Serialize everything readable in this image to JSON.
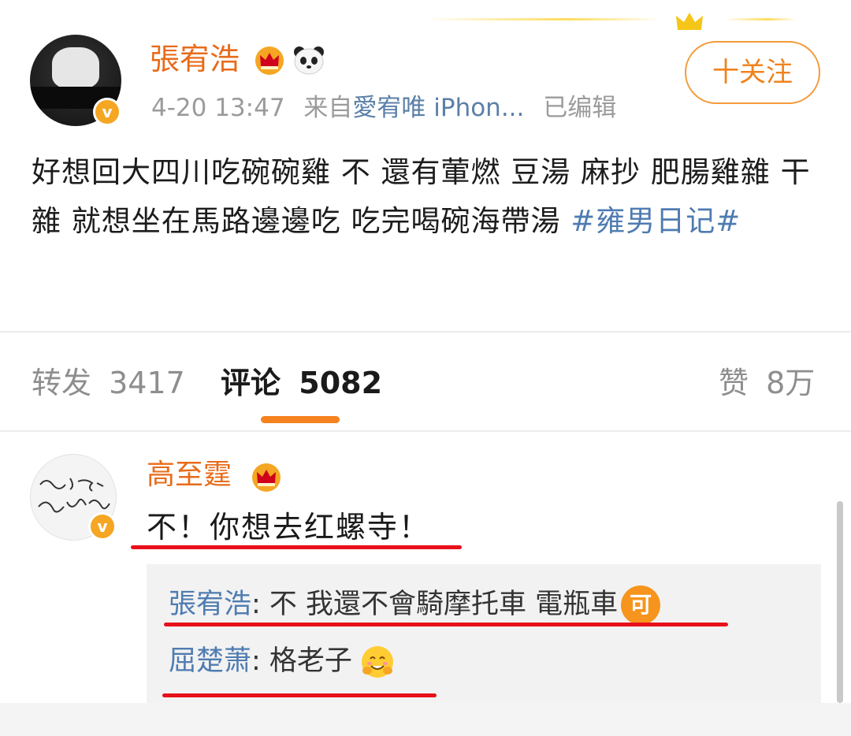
{
  "post": {
    "author": "張宥浩",
    "time": "4-20 13:47",
    "source_prefix": "来自",
    "source": "愛宥唯 iPhon...",
    "edited": "已编辑",
    "follow_label": "十关注",
    "text": "好想回大四川吃碗碗雞 不 還有葷燃 豆湯 麻抄 肥腸雞雜 干雜 就想坐在馬路邊邊吃 吃完喝碗海帶湯 ",
    "hashtag": "#雍男日记#"
  },
  "stats": {
    "repost_label": "转发",
    "repost_count": "3417",
    "comment_label": "评论",
    "comment_count": "5082",
    "like_label": "赞",
    "like_count": "8万"
  },
  "comment": {
    "author": "高至霆",
    "text": "不！你想去红螺寺！",
    "replies": [
      {
        "name": "張宥浩",
        "text": ": 不 我還不會騎摩托車 電瓶車",
        "emoji": "可"
      },
      {
        "name": "屈楚萧",
        "text": ": 格老子"
      }
    ]
  },
  "colors": {
    "accent_orange": "#f5821f",
    "name_orange": "#e86b1a",
    "link_blue": "#4f7cb1",
    "annotation_red": "#e8101a"
  },
  "icons": [
    "crown-icon",
    "panda-icon",
    "verified-badge-icon",
    "laugh-emoji-icon",
    "hug-emoji-icon"
  ]
}
